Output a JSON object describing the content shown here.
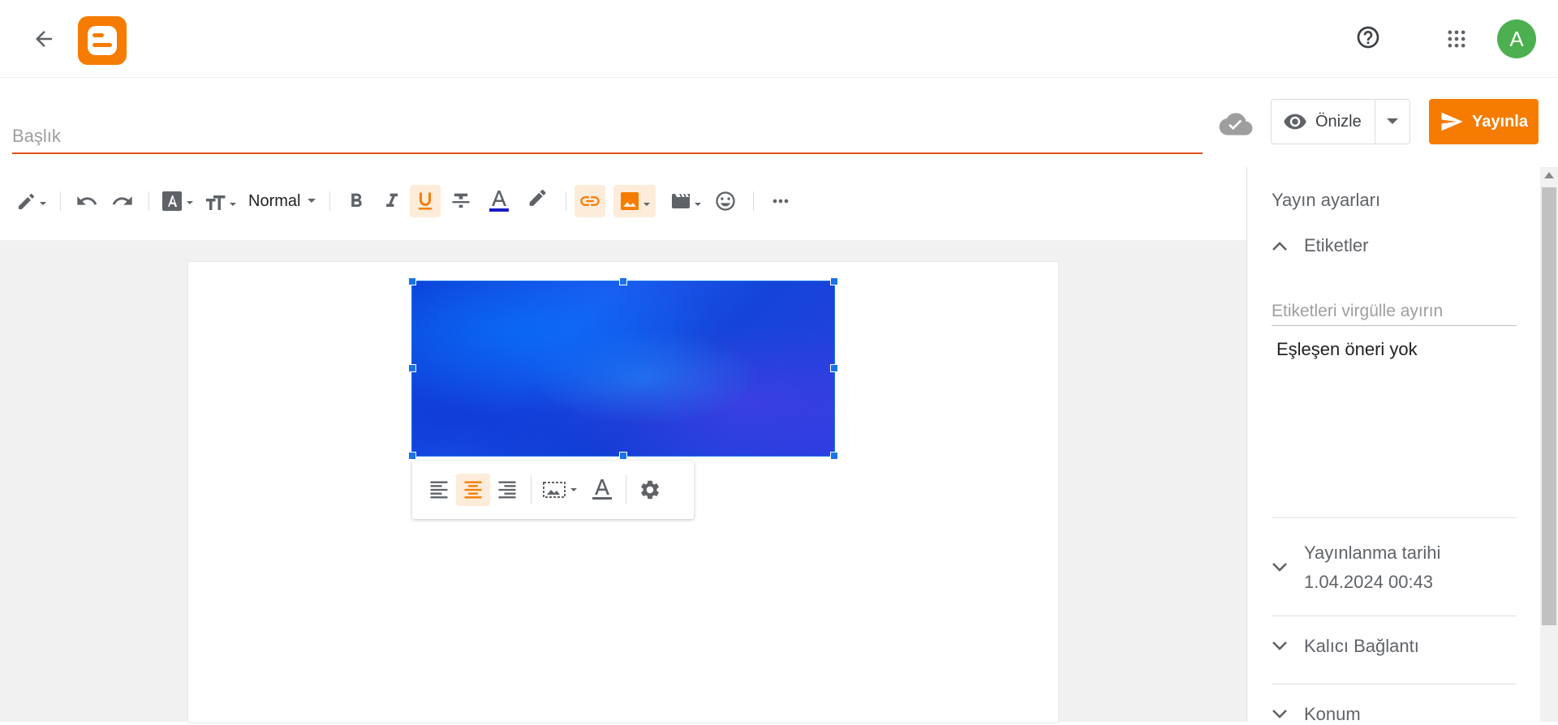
{
  "header": {
    "back_icon": "arrow-back-icon",
    "logo_icon": "blogger-logo-icon",
    "help_icon": "help-circle-icon",
    "apps_icon": "apps-grid-icon",
    "avatar_letter": "A",
    "avatar_color": "#4caf50"
  },
  "editor": {
    "title_placeholder": "Başlık",
    "preview_label": "Önizle",
    "publish_label": "Yayınla",
    "accent_color": "#f57c00"
  },
  "toolbar": {
    "paragraph_style": "Normal"
  },
  "sidebar": {
    "title": "Yayın ayarları",
    "labels_heading": "Etiketler",
    "labels_placeholder": "Etiketleri virgülle ayırın",
    "no_suggestion": "Eşleşen öneri yok",
    "publish_date_heading": "Yayınlanma tarihi",
    "publish_date_value": "1.04.2024 00:43",
    "permalink_heading": "Kalıcı Bağlantı",
    "location_heading": "Konum"
  }
}
